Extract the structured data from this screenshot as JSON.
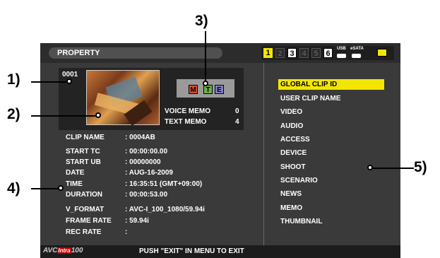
{
  "header": {
    "title": "PROPERTY"
  },
  "slots": {
    "items": [
      "1",
      "2",
      "3",
      "4",
      "5",
      "6"
    ],
    "usb_label": "USB",
    "esata_label": "eSATA"
  },
  "clip": {
    "number": "0001",
    "memo_badges": [
      "M",
      "T",
      "E"
    ],
    "voice_memo_label": "VOICE MEMO",
    "voice_memo_value": "0",
    "text_memo_label": "TEXT MEMO",
    "text_memo_value": "4"
  },
  "fields": [
    {
      "label": "CLIP NAME",
      "value": ": 0004AB"
    },
    {
      "label": "START TC",
      "value": ": 00:00:00.00"
    },
    {
      "label": "START UB",
      "value": ": 00000000"
    },
    {
      "label": "DATE",
      "value": ": AUG-16-2009"
    },
    {
      "label": "TIME",
      "value": ": 16:35:51 (GMT+09:00)"
    },
    {
      "label": "DURATION",
      "value": ": 00:00:53.00"
    },
    {
      "label": "V_FORMAT",
      "value": ": AVC-I_100_1080/59.94i"
    },
    {
      "label": "FRAME RATE",
      "value": ": 59.94i"
    },
    {
      "label": "REC RATE",
      "value": ":"
    }
  ],
  "menu": {
    "items": [
      "GLOBAL CLIP ID",
      "USER CLIP NAME",
      "VIDEO",
      "AUDIO",
      "ACCESS",
      "DEVICE",
      "SHOOT",
      "SCENARIO",
      "NEWS",
      "MEMO",
      "THUMBNAIL"
    ],
    "selected_index": 0
  },
  "footer": {
    "brand_prefix": "AVC",
    "brand_intra": "Intra",
    "brand_suffix": "100",
    "message": "PUSH \"EXIT\" IN MENU TO EXIT"
  },
  "callouts": [
    "1)",
    "2)",
    "3)",
    "4)",
    "5)"
  ],
  "colors": {
    "accent": "#f2e600",
    "background": "#3a3a3a",
    "bar": "#2c2c2c"
  }
}
